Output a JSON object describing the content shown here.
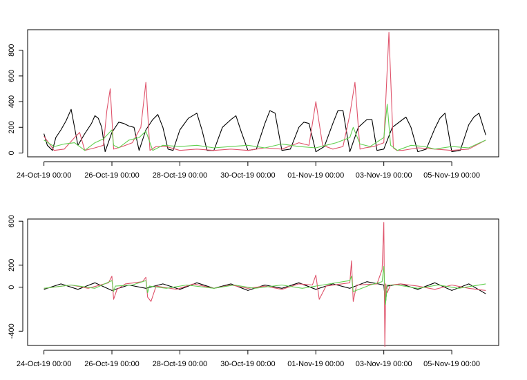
{
  "chart_data": [
    {
      "type": "line",
      "x_ticks": [
        "24-Oct-19 00:00",
        "26-Oct-19 00:00",
        "28-Oct-19 00:00",
        "30-Oct-19 00:00",
        "01-Nov-19 00:00",
        "03-Nov-19 00:00",
        "05-Nov-19 00:00"
      ],
      "x_tick_days": [
        0,
        2,
        4,
        6,
        8,
        10,
        12
      ],
      "xlim_days": [
        -0.48,
        13.38
      ],
      "y_ticks": [
        0,
        200,
        400,
        600,
        800
      ],
      "ylim": [
        -30,
        960
      ],
      "grid": false,
      "colors": [
        "#000000",
        "#df536b",
        "#61d04f"
      ],
      "series": [
        {
          "color": "#000000",
          "x_days": [
            0.0,
            0.1,
            0.25,
            0.35,
            0.5,
            0.65,
            0.8,
            1.0,
            1.2,
            1.4,
            1.5,
            1.6,
            1.7,
            1.8,
            2.0,
            2.2,
            2.35,
            2.5,
            2.65,
            2.8,
            3.0,
            3.2,
            3.35,
            3.5,
            3.65,
            3.8,
            4.0,
            4.25,
            4.5,
            4.65,
            4.8,
            5.0,
            5.25,
            5.5,
            5.65,
            5.8,
            6.0,
            6.25,
            6.5,
            6.65,
            6.8,
            7.0,
            7.25,
            7.5,
            7.65,
            7.8,
            8.0,
            8.25,
            8.5,
            8.65,
            8.8,
            9.0,
            9.25,
            9.5,
            9.65,
            9.8,
            10.0,
            10.25,
            10.5,
            10.65,
            10.8,
            11.0,
            11.25,
            11.5,
            11.65,
            11.8,
            12.0,
            12.25,
            12.5,
            12.65,
            12.8,
            13.0
          ],
          "values": [
            150,
            60,
            20,
            120,
            180,
            250,
            340,
            60,
            150,
            230,
            290,
            270,
            200,
            10,
            160,
            240,
            230,
            210,
            200,
            20,
            180,
            260,
            300,
            200,
            30,
            20,
            180,
            270,
            310,
            180,
            20,
            20,
            200,
            260,
            290,
            170,
            20,
            30,
            230,
            330,
            310,
            20,
            30,
            200,
            240,
            230,
            10,
            50,
            230,
            330,
            330,
            10,
            200,
            260,
            260,
            20,
            30,
            200,
            250,
            280,
            200,
            10,
            30,
            190,
            270,
            310,
            10,
            20,
            220,
            280,
            310,
            140
          ]
        },
        {
          "color": "#df536b",
          "x_days": [
            0.0,
            0.3,
            0.6,
            0.9,
            1.05,
            1.2,
            1.5,
            1.75,
            1.85,
            1.95,
            2.05,
            2.3,
            2.6,
            2.85,
            3.0,
            3.12,
            3.3,
            3.6,
            4.0,
            4.5,
            5.0,
            5.5,
            6.0,
            6.5,
            7.0,
            7.5,
            7.8,
            8.0,
            8.2,
            8.5,
            8.8,
            9.0,
            9.15,
            9.3,
            9.45,
            9.7,
            10.0,
            10.15,
            10.28,
            10.38,
            10.55,
            11.0,
            11.5,
            12.0,
            12.5,
            13.0
          ],
          "values": [
            130,
            20,
            30,
            120,
            160,
            20,
            40,
            60,
            330,
            500,
            30,
            50,
            80,
            200,
            550,
            20,
            50,
            50,
            20,
            30,
            20,
            30,
            20,
            40,
            30,
            80,
            60,
            400,
            60,
            30,
            50,
            300,
            550,
            30,
            40,
            50,
            80,
            940,
            40,
            20,
            20,
            40,
            30,
            20,
            30,
            100
          ]
        },
        {
          "color": "#61d04f",
          "x_days": [
            0.0,
            0.3,
            0.6,
            0.9,
            1.2,
            1.5,
            1.75,
            2.0,
            2.05,
            2.2,
            2.5,
            2.8,
            3.0,
            3.2,
            3.5,
            4.0,
            4.5,
            5.0,
            5.5,
            6.0,
            6.5,
            7.0,
            7.5,
            8.0,
            8.3,
            8.6,
            9.0,
            9.1,
            9.3,
            9.6,
            10.0,
            10.1,
            10.2,
            10.4,
            10.8,
            11.2,
            11.5,
            12.0,
            12.5,
            13.0
          ],
          "values": [
            100,
            50,
            70,
            80,
            20,
            80,
            110,
            180,
            60,
            40,
            100,
            120,
            170,
            20,
            60,
            50,
            60,
            40,
            50,
            60,
            40,
            70,
            50,
            40,
            60,
            80,
            120,
            200,
            70,
            50,
            120,
            380,
            60,
            20,
            60,
            50,
            30,
            50,
            40,
            100
          ]
        }
      ]
    },
    {
      "type": "line",
      "x_ticks": [
        "24-Oct-19 00:00",
        "26-Oct-19 00:00",
        "28-Oct-19 00:00",
        "30-Oct-19 00:00",
        "01-Nov-19 00:00",
        "03-Nov-19 00:00",
        "05-Nov-19 00:00"
      ],
      "x_tick_days": [
        0,
        2,
        4,
        6,
        8,
        10,
        12
      ],
      "xlim_days": [
        -0.48,
        13.38
      ],
      "y_ticks": [
        -400,
        0,
        200,
        600
      ],
      "ylim": [
        -530,
        620
      ],
      "grid": false,
      "colors": [
        "#000000",
        "#df536b",
        "#61d04f"
      ],
      "series": [
        {
          "color": "#000000",
          "x_days": [
            0.0,
            0.5,
            1.0,
            1.5,
            2.0,
            2.5,
            3.0,
            3.5,
            4.0,
            4.5,
            5.0,
            5.5,
            6.0,
            6.5,
            7.0,
            7.5,
            8.0,
            8.5,
            9.0,
            9.5,
            10.0,
            10.05,
            10.1,
            10.5,
            11.0,
            11.5,
            12.0,
            12.5,
            13.0
          ],
          "values": [
            -20,
            30,
            -20,
            40,
            -30,
            20,
            -10,
            30,
            -20,
            40,
            -10,
            30,
            -30,
            20,
            -10,
            40,
            -20,
            30,
            -10,
            50,
            20,
            -150,
            10,
            30,
            -20,
            40,
            -30,
            30,
            -60
          ]
        },
        {
          "color": "#df536b",
          "x_days": [
            0.0,
            0.8,
            1.3,
            1.9,
            2.0,
            2.05,
            2.15,
            2.4,
            2.9,
            3.0,
            3.05,
            3.15,
            3.3,
            3.9,
            4.4,
            5.0,
            5.5,
            6.0,
            6.5,
            7.0,
            7.5,
            7.9,
            8.0,
            8.1,
            8.3,
            9.0,
            9.05,
            9.1,
            9.2,
            9.8,
            9.95,
            10.0,
            10.03,
            10.06,
            10.1,
            10.2,
            10.5,
            11.0,
            11.5,
            12.0,
            12.5,
            13.0
          ],
          "values": [
            -10,
            20,
            -10,
            40,
            100,
            -110,
            -20,
            30,
            50,
            90,
            -90,
            -130,
            10,
            -20,
            30,
            -10,
            20,
            -10,
            10,
            -20,
            30,
            20,
            110,
            -110,
            10,
            40,
            240,
            -130,
            20,
            30,
            160,
            590,
            -540,
            30,
            -50,
            20,
            30,
            10,
            -20,
            20,
            -10,
            -30
          ]
        },
        {
          "color": "#61d04f",
          "x_days": [
            0.0,
            0.8,
            1.5,
            2.0,
            2.05,
            2.1,
            2.6,
            3.0,
            3.05,
            3.1,
            3.6,
            4.2,
            5.0,
            5.6,
            6.2,
            7.0,
            7.6,
            8.2,
            9.0,
            9.05,
            9.1,
            9.6,
            9.95,
            10.0,
            10.05,
            10.1,
            10.4,
            11.0,
            11.6,
            12.2,
            13.0
          ],
          "values": [
            -10,
            20,
            -10,
            60,
            -40,
            10,
            20,
            60,
            -50,
            10,
            -10,
            20,
            -10,
            20,
            -10,
            20,
            -10,
            20,
            60,
            100,
            -40,
            20,
            50,
            190,
            -160,
            20,
            20,
            -10,
            20,
            -10,
            30
          ]
        }
      ]
    }
  ]
}
